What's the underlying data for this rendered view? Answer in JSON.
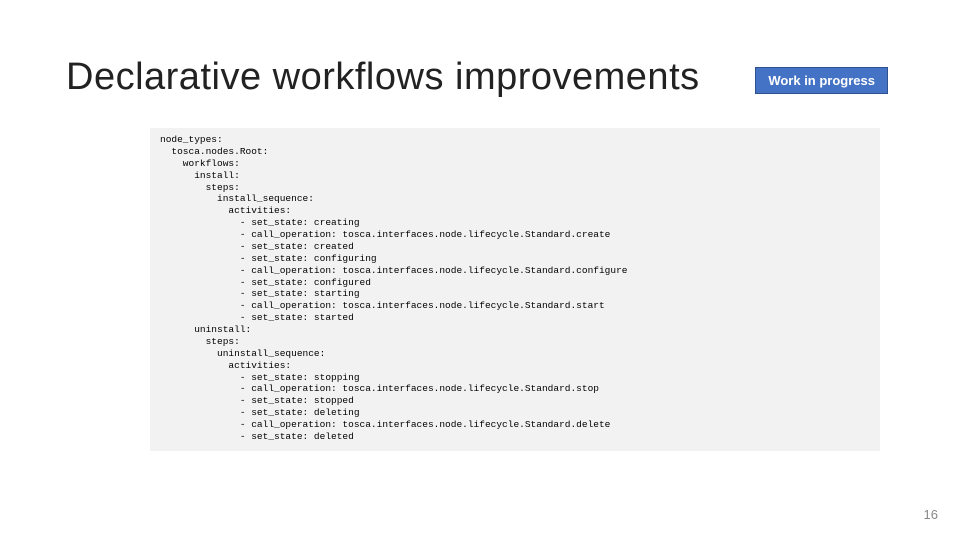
{
  "title": "Declarative workflows improvements",
  "badge": "Work in progress",
  "code": "node_types:\n  tosca.nodes.Root:\n    workflows:\n      install:\n        steps:\n          install_sequence:\n            activities:\n              - set_state: creating\n              - call_operation: tosca.interfaces.node.lifecycle.Standard.create\n              - set_state: created\n              - set_state: configuring\n              - call_operation: tosca.interfaces.node.lifecycle.Standard.configure\n              - set_state: configured\n              - set_state: starting\n              - call_operation: tosca.interfaces.node.lifecycle.Standard.start\n              - set_state: started\n      uninstall:\n        steps:\n          uninstall_sequence:\n            activities:\n              - set_state: stopping\n              - call_operation: tosca.interfaces.node.lifecycle.Standard.stop\n              - set_state: stopped\n              - set_state: deleting\n              - call_operation: tosca.interfaces.node.lifecycle.Standard.delete\n              - set_state: deleted",
  "page_number": "16"
}
